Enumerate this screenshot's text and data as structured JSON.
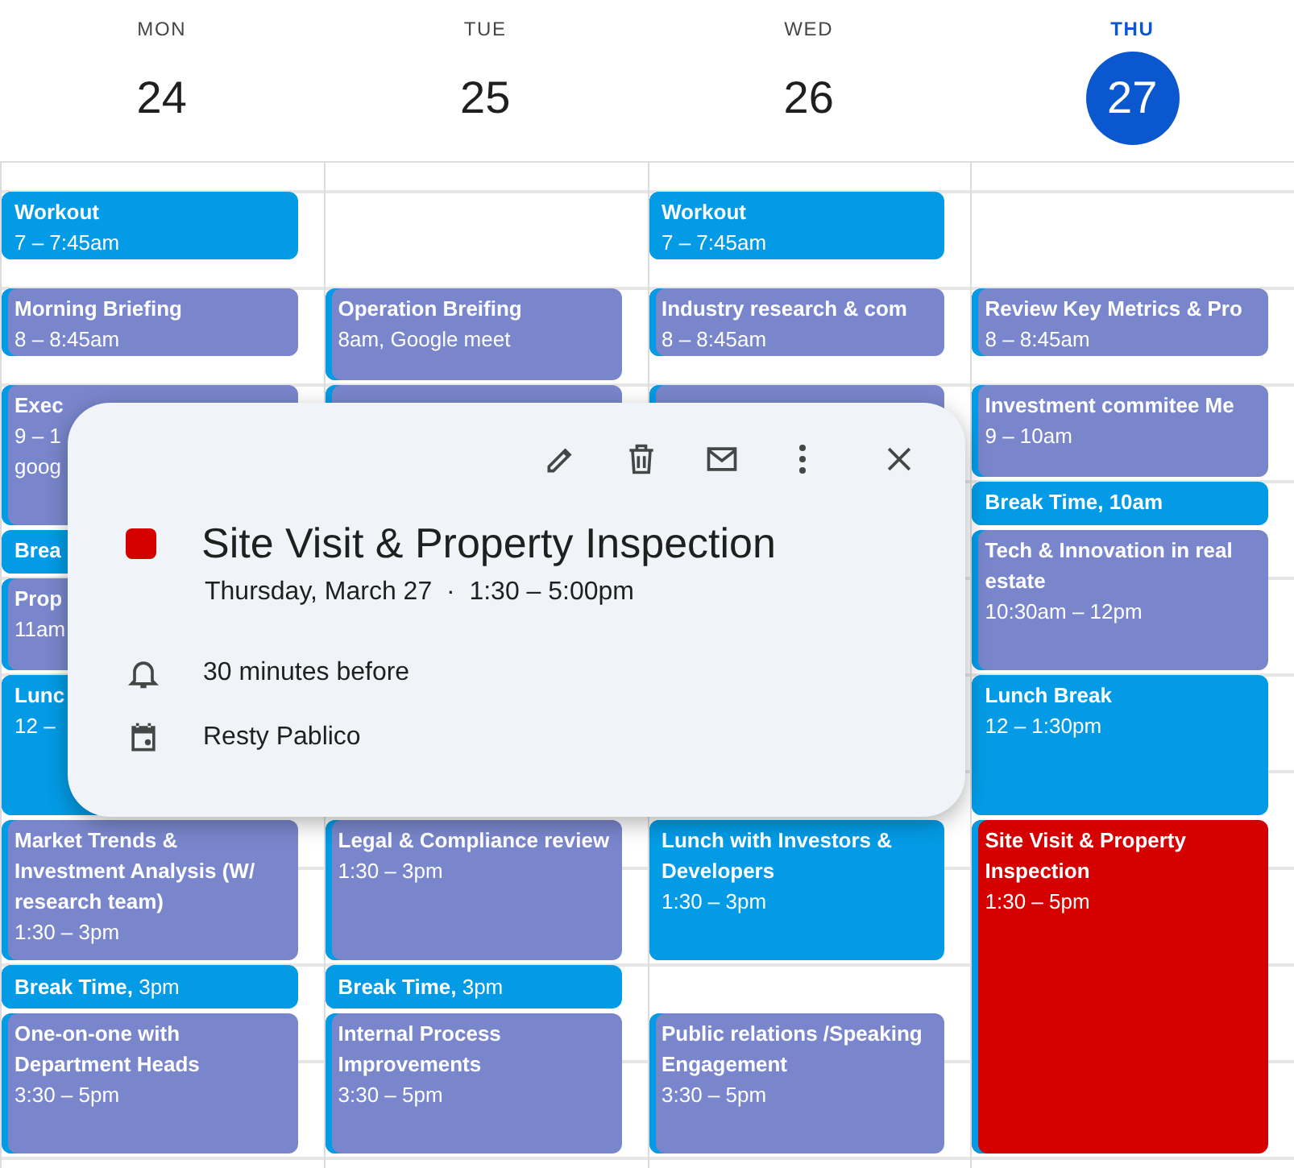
{
  "days": [
    {
      "weekday": "MON",
      "date": "24",
      "selected": false,
      "events": [
        {
          "title": "Workout",
          "time": "7 – 7:45am",
          "color": "#039be5"
        },
        {
          "title": "Morning Briefing",
          "time": "8 – 8:45am",
          "color": "#7986cb"
        },
        {
          "title": "Exec",
          "time": "9 – 1",
          "note": "goog",
          "color": "#7986cb"
        },
        {
          "title": "Brea",
          "color": "#039be5"
        },
        {
          "title": "Prop",
          "time": "11am",
          "color": "#7986cb"
        },
        {
          "title": "Lunc",
          "time": "12 –",
          "color": "#039be5"
        },
        {
          "title": "Market Trends & Investment Analysis (W/ research team)",
          "time": "1:30 – 3pm",
          "color": "#7986cb"
        },
        {
          "title": "Break Time,",
          "time": "3pm",
          "kind": "inline",
          "color": "#039be5"
        },
        {
          "title": "One-on-one with Department Heads",
          "time": "3:30 – 5pm",
          "color": "#7986cb"
        }
      ]
    },
    {
      "weekday": "TUE",
      "date": "25",
      "selected": false,
      "events": [
        {
          "title": "Operation Breifing",
          "time": "8am, Google meet",
          "color": "#7986cb"
        },
        {
          "color": "#7986cb"
        },
        {
          "title": "Legal & Compliance review",
          "time": "1:30 – 3pm",
          "color": "#7986cb"
        },
        {
          "title": "Break Time,",
          "time": "3pm",
          "kind": "inline",
          "color": "#039be5"
        },
        {
          "title": "Internal Process Improvements",
          "time": "3:30 – 5pm",
          "color": "#7986cb"
        }
      ]
    },
    {
      "weekday": "WED",
      "date": "26",
      "selected": false,
      "events": [
        {
          "title": "Workout",
          "time": "7 – 7:45am",
          "color": "#039be5"
        },
        {
          "title": "Industry research & com",
          "time": "8 – 8:45am",
          "color": "#7986cb"
        },
        {
          "color": "#7986cb"
        },
        {
          "title": "Lunch with Investors & Developers",
          "time": "1:30 – 3pm",
          "color": "#039be5"
        },
        {
          "title": "Public relations /Speaking Engagement",
          "time": "3:30 – 5pm",
          "color": "#7986cb"
        }
      ]
    },
    {
      "weekday": "THU",
      "date": "27",
      "selected": true,
      "events": [
        {
          "title": "Review Key Metrics & Pro",
          "time": "8 – 8:45am",
          "color": "#7986cb"
        },
        {
          "title": "Investment commitee Me",
          "time": "9 – 10am",
          "color": "#7986cb"
        },
        {
          "title": "Break Time, 10am",
          "color": "#039be5"
        },
        {
          "title": "Tech & Innovation in real estate",
          "time": "10:30am – 12pm",
          "color": "#7986cb"
        },
        {
          "title": "Lunch Break",
          "time": "12 – 1:30pm",
          "color": "#039be5"
        },
        {
          "title": "Site Visit & Property Inspection",
          "time": "1:30 – 5pm",
          "color": "#d50000"
        }
      ]
    }
  ],
  "popup": {
    "title": "Site Visit & Property Inspection",
    "color": "#d50000",
    "when": "Thursday, March 27  ·  1:30 – 5:00pm",
    "reminder": "30 minutes before",
    "calendar": "Resty Pablico"
  }
}
